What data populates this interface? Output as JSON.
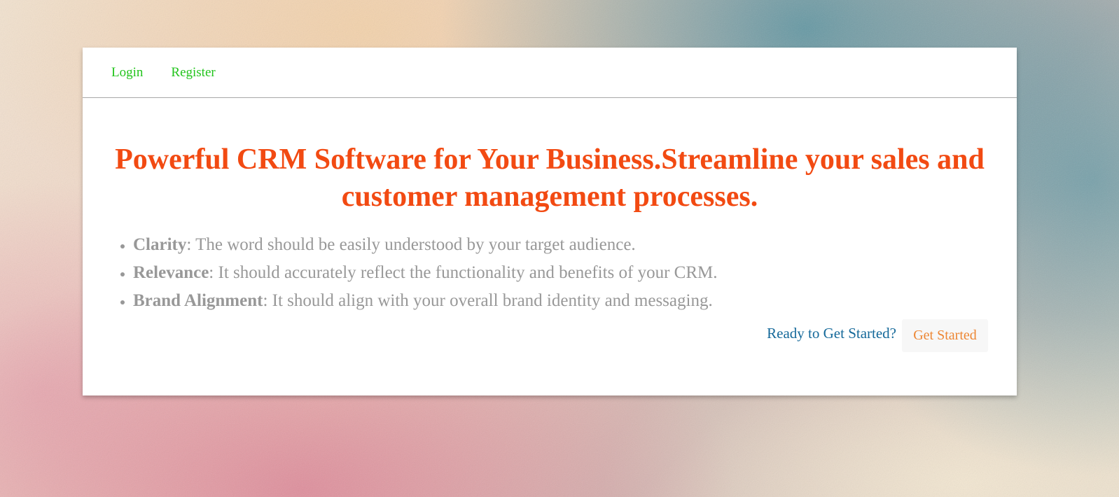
{
  "nav": {
    "login_label": "Login",
    "register_label": "Register"
  },
  "hero": {
    "title": "Powerful CRM Software for Your Business.Streamline your sales and customer management processes."
  },
  "features": [
    {
      "term": "Clarity",
      "desc": ": The word should be easily understood by your target audience."
    },
    {
      "term": "Relevance",
      "desc": ": It should accurately reflect the functionality and benefits of your CRM."
    },
    {
      "term": "Brand Alignment",
      "desc": ": It should align with your overall brand identity and messaging."
    }
  ],
  "cta": {
    "prompt": "Ready to Get Started?",
    "button_label": "Get Started"
  },
  "colors": {
    "nav_link": "#22c41c",
    "title": "#f24a12",
    "feature_text": "#989898",
    "cta_prompt": "#15699a",
    "cta_button_text": "#ed8633"
  }
}
